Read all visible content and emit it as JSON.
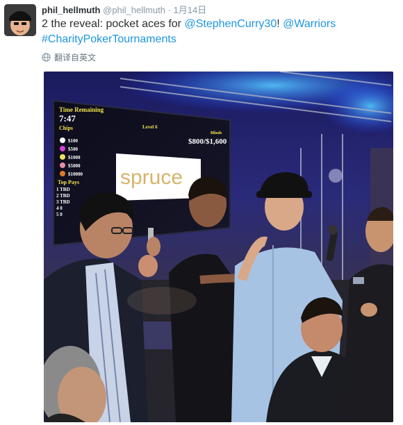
{
  "tweet": {
    "display_name": "phil_hellmuth",
    "handle": "@phil_hellmuth",
    "separator": "·",
    "date": "1月14日",
    "text_plain": "2 the reveal: pocket aces for ",
    "mention_1": "@StephenCurry30",
    "text_sep": "!  ",
    "mention_2": "@Warriors",
    "hashtag": "#CharityPokerTournaments",
    "translate_label": "翻译自英文"
  },
  "screen": {
    "time_remaining_label": "Time Remaining",
    "time_value": "7:47",
    "level_label": "Level 6",
    "blinds_label": "Blinds",
    "blinds_value": "$800/$1,600",
    "chips_label": "Chips",
    "chip_values": [
      "$100",
      "$500",
      "$1000",
      "$5000",
      "$10000"
    ],
    "top_pays_label": "Top Pays",
    "pays": [
      "1 TBD",
      "2 TBD",
      "3 TBD",
      "4 0",
      "5 0"
    ],
    "sponsor_logo": "spruce"
  },
  "colors": {
    "link": "#1b95e0",
    "muted": "#8899a6",
    "text": "#292f33"
  }
}
